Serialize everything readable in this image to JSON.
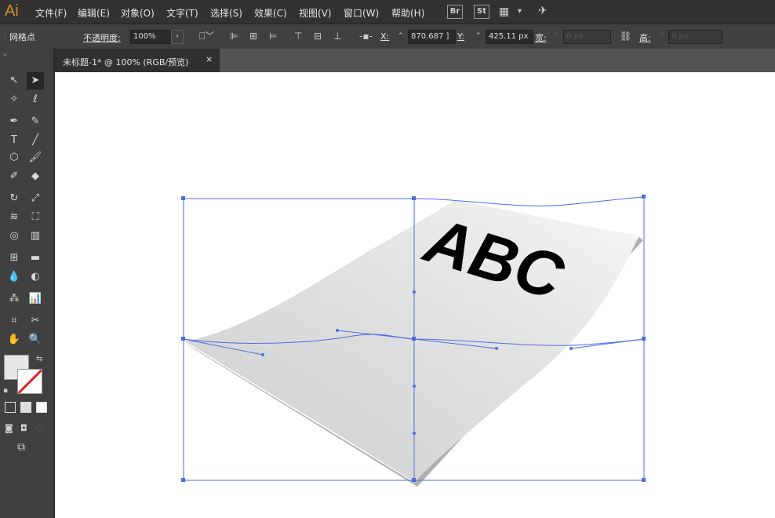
{
  "app": {
    "logo": "Ai"
  },
  "menu": [
    "文件(F)",
    "编辑(E)",
    "对象(O)",
    "文字(T)",
    "选择(S)",
    "效果(C)",
    "视图(V)",
    "窗口(W)",
    "帮助(H)"
  ],
  "toolbar_icons": {
    "br": "Br",
    "st": "St",
    "arrange": "grid-layout-icon",
    "gpu": "rocket-icon"
  },
  "control_bar": {
    "selection_label": "网格点",
    "opacity_label": "不透明度:",
    "opacity_value": "100%",
    "x_label": "X:",
    "x_value": "870.687 ]",
    "y_label": "Y:",
    "y_value": "425.11 px",
    "w_label": "宽:",
    "w_value": "0 px",
    "h_label": "高:",
    "h_value": "0 px"
  },
  "document_tab": {
    "title": "未标题-1* @ 100% (RGB/预览)",
    "close": "×"
  },
  "artwork": {
    "text": "ABC"
  },
  "colors": {
    "selection": "#4a6ee0",
    "text": "#000000",
    "canvas": "#ffffff",
    "workspace": "#535353"
  }
}
